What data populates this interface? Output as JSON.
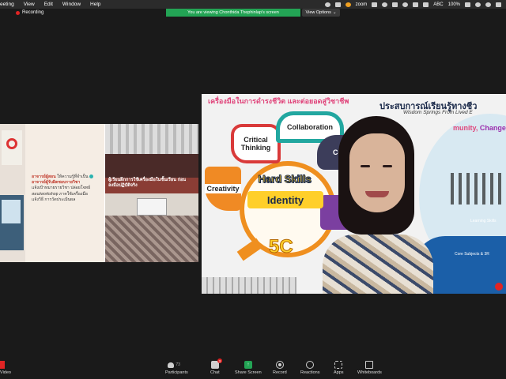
{
  "menubar": {
    "items": [
      "eeting",
      "View",
      "Edit",
      "Window",
      "Help"
    ],
    "zoom_app": "zoom",
    "keyboard": "ABC",
    "battery": "100%"
  },
  "meeting": {
    "recording_label": "Recording",
    "share_banner": "You are viewing Chonthida Thephinlap's screen",
    "view_options": "View Options",
    "view_options_caret": "⌄"
  },
  "slide_left": {
    "text_line1_highlight": "อาจารย์ผู้สอน",
    "text_line1": " ให้ความรู้ที่จำเป็น",
    "text_line2_highlight": "อาจารย์ผู้รับผิดชอบรายวิชา",
    "text_line3": "แจ้งเป้าหมายรายวิชา ปล่อยโจทย์",
    "text_line4": "สอน/workshop ภาคใช้เครื่องมือ",
    "text_line5": "แจ้งวิธี การวัดประเมินผล",
    "photo_caption": "ผู้เรียนฝึกการใช้เครื่องมือในชั้นเรียน ก่อนลงมือปฏิบัติจริง"
  },
  "slide_right": {
    "thai_title": "เครื่องมือในการดำรงชีวิต และต่อยอดสู่วิชาชีพ",
    "en_title": "ประสบการณ์เรียนรู้ทางชีว",
    "en_subtitle": "Wisdom Springs From Lived E",
    "petals": {
      "critical": "Critical Thinking",
      "collaboration": "Collaboration",
      "communication": "Comm",
      "creativity": "Creativity",
      "fifth": "Co"
    },
    "hard_skills": "Hard Skills",
    "identity": "Identity",
    "five_c": "5C",
    "arc_text_a": "munity, ",
    "arc_text_b": "Change, A",
    "learning_skills": "Learning Skills",
    "core_subjects": "Core Subjects & 3R"
  },
  "toolbar": {
    "video": "Video",
    "participants": "Participants",
    "participants_count": "73",
    "chat": "Chat",
    "chat_badge": "3",
    "share_screen": "Share Screen",
    "record": "Record",
    "reactions": "Reactions",
    "apps": "Apps",
    "whiteboards": "Whiteboards"
  }
}
